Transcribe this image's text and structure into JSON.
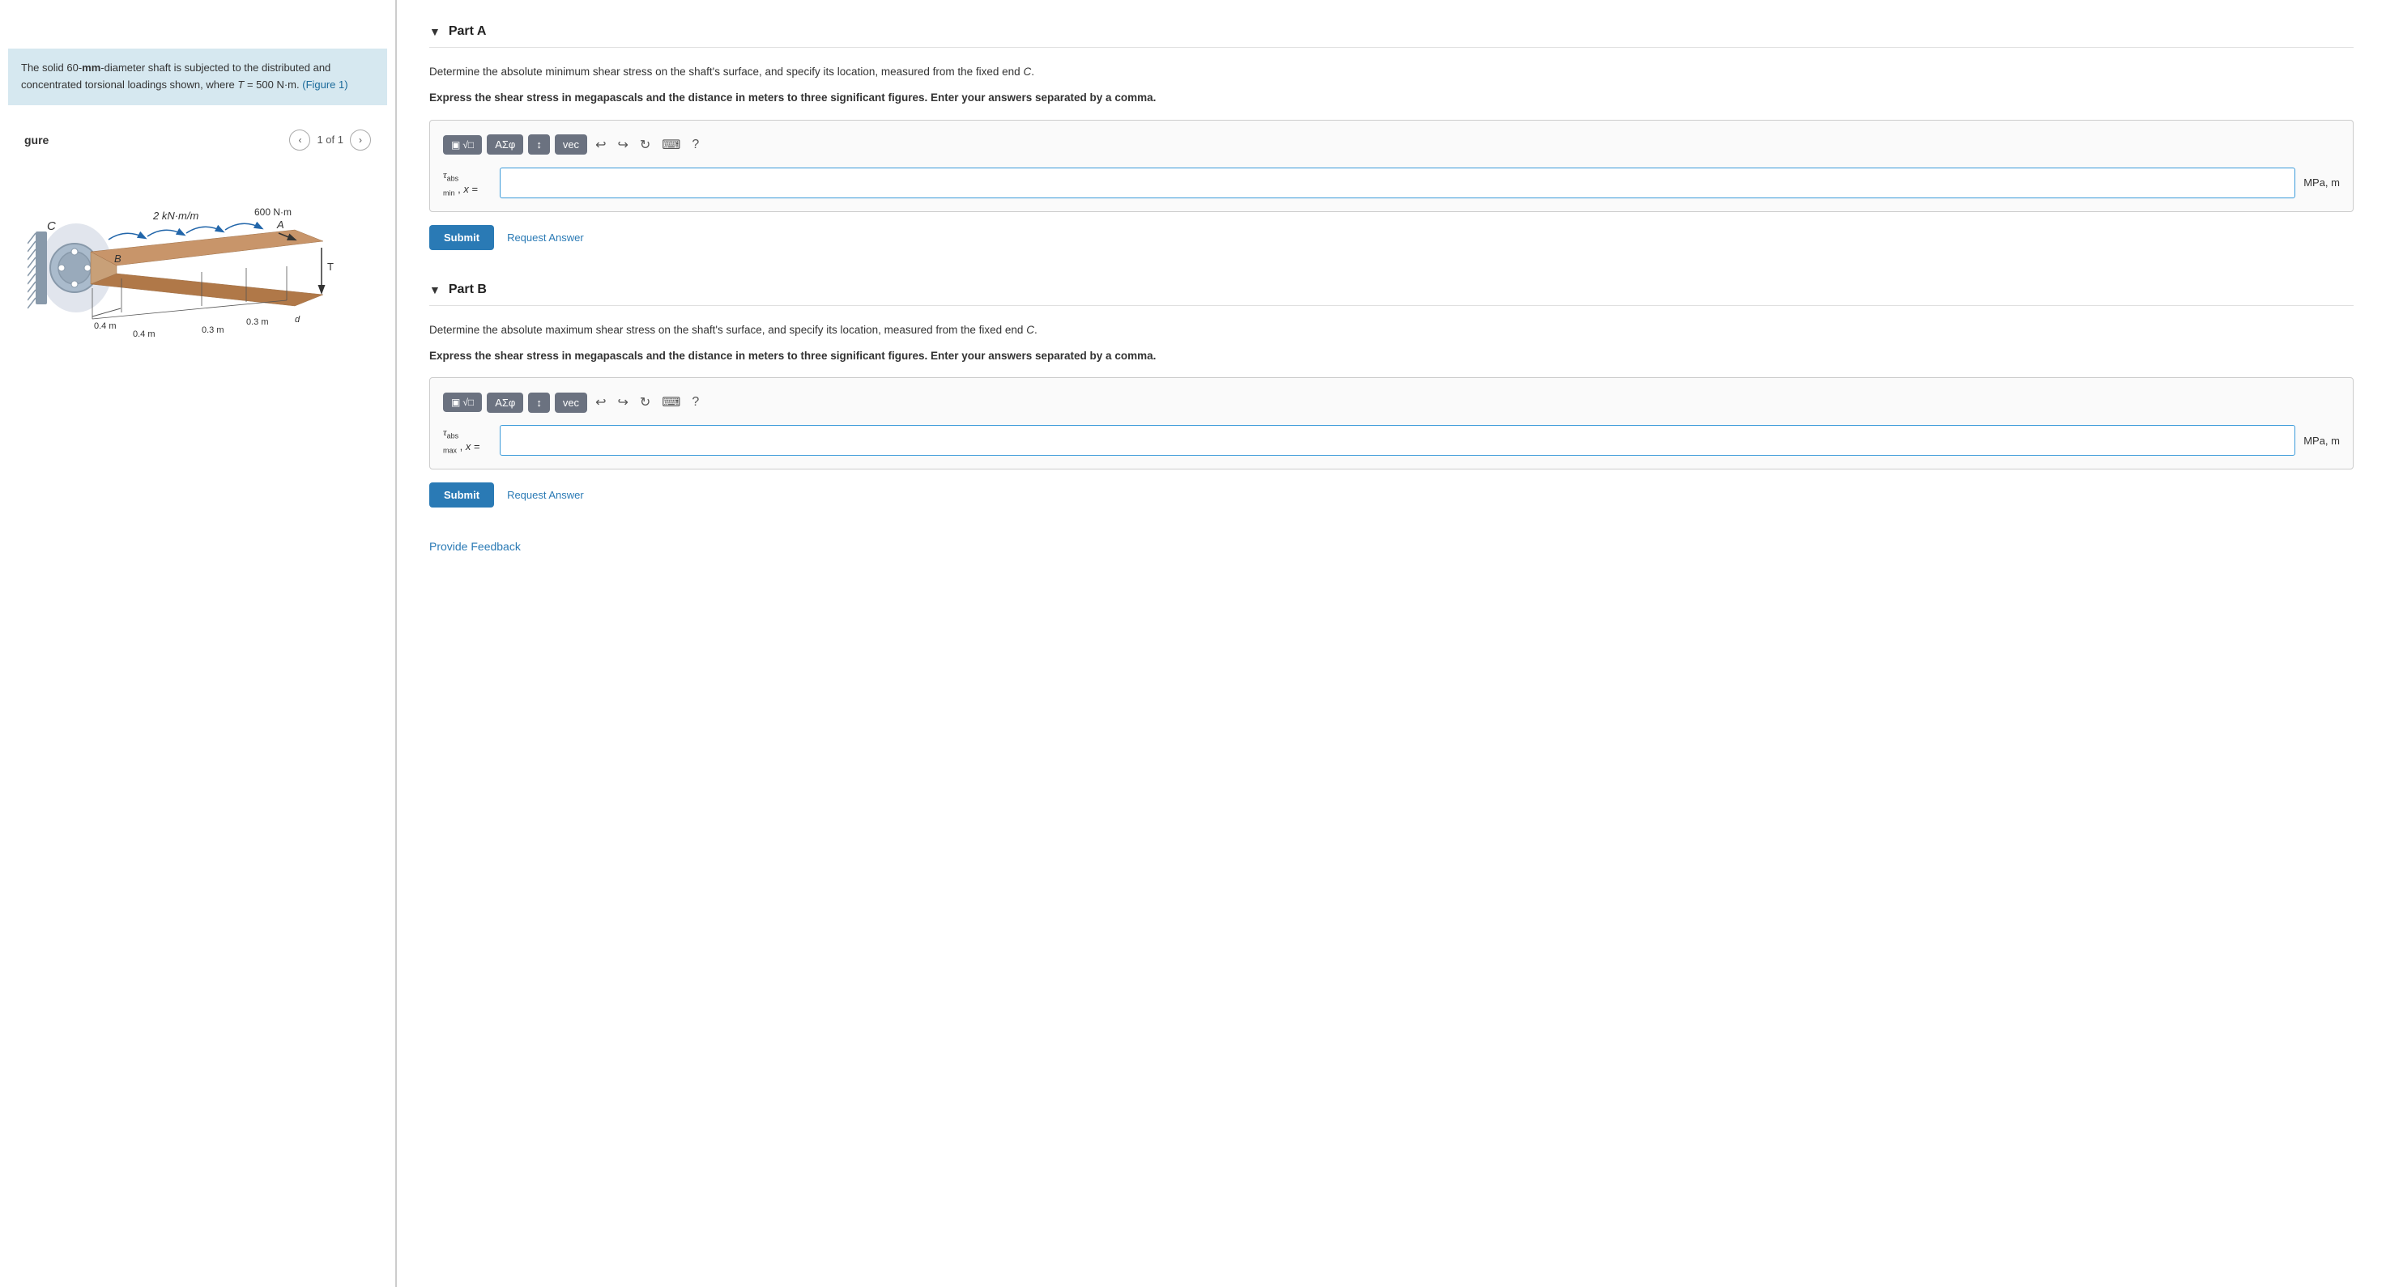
{
  "left_panel": {
    "problem_statement": "The solid 60-mm-diameter shaft is subjected to the distributed and concentrated torsional loadings shown, where T = 500 N·m.",
    "figure_link": "(Figure 1)",
    "figure_label": "gure",
    "figure_nav": {
      "current": "1",
      "total": "1",
      "of_label": "of"
    }
  },
  "right_panel": {
    "part_a": {
      "title": "Part A",
      "collapse_arrow": "▼",
      "description": "Determine the absolute minimum shear stress on the shaft's surface, and specify its location, measured from the fixed end C.",
      "instruction": "Express the shear stress in megapascals and the distance in meters to three significant figures. Enter your answers separated by a comma.",
      "input_label": "τ abs min , x =",
      "input_placeholder": "",
      "input_unit": "MPa, m",
      "submit_label": "Submit",
      "request_answer_label": "Request Answer",
      "toolbar": {
        "matrix_btn": "▣√□",
        "symbol_btn": "ΑΣφ",
        "format_btn": "↕",
        "vec_btn": "vec",
        "undo_icon": "↩",
        "redo_icon": "↪",
        "refresh_icon": "↻",
        "keyboard_icon": "⌨",
        "help_icon": "?"
      }
    },
    "part_b": {
      "title": "Part B",
      "collapse_arrow": "▼",
      "description": "Determine the absolute maximum shear stress on the shaft's surface, and specify its location, measured from the fixed end C.",
      "instruction": "Express the shear stress in megapascals and the distance in meters to three significant figures. Enter your answers separated by a comma.",
      "input_label": "τ abs max , x =",
      "input_placeholder": "",
      "input_unit": "MPa, m",
      "submit_label": "Submit",
      "request_answer_label": "Request Answer",
      "toolbar": {
        "matrix_btn": "▣√□",
        "symbol_btn": "ΑΣφ",
        "format_btn": "↕",
        "vec_btn": "vec",
        "undo_icon": "↩",
        "redo_icon": "↪",
        "refresh_icon": "↻",
        "keyboard_icon": "⌨",
        "help_icon": "?"
      }
    },
    "provide_feedback_label": "Provide Feedback"
  }
}
